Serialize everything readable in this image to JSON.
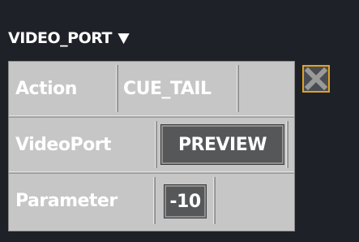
{
  "header": {
    "title": "VIDEO_PORT",
    "arrow": "▼",
    "arrow_icon": "triangle-down-icon"
  },
  "close_icon": "close-icon",
  "colors": {
    "background": "#1e2127",
    "panel": "#c6c6c6",
    "value_box": "#555759",
    "close_border": "#e2a320"
  },
  "rows": [
    {
      "label": "Action",
      "value": "CUE_TAIL"
    },
    {
      "label": "VideoPort",
      "value": "PREVIEW"
    },
    {
      "label": "Parameter",
      "value": "-10"
    }
  ]
}
